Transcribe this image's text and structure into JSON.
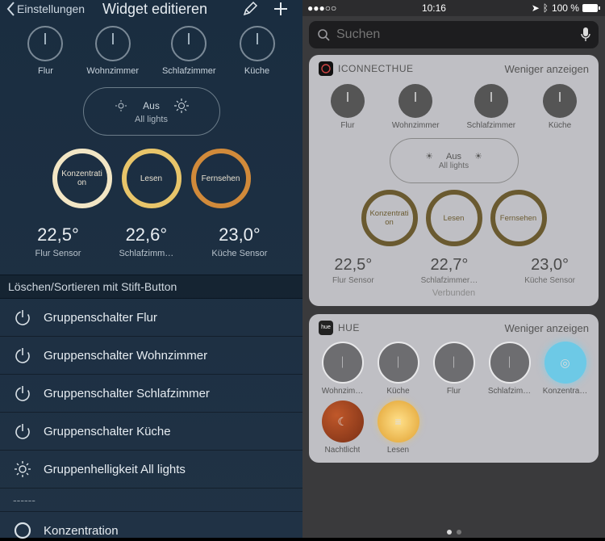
{
  "left": {
    "back_label": "Einstellungen",
    "title": "Widget editieren",
    "powers": [
      {
        "label": "Flur"
      },
      {
        "label": "Wohnzimmer"
      },
      {
        "label": "Schlafzimmer"
      },
      {
        "label": "Küche"
      }
    ],
    "all_lights": {
      "state": "Aus",
      "label": "All lights"
    },
    "scenes": [
      {
        "label": "Konzentration"
      },
      {
        "label": "Lesen"
      },
      {
        "label": "Fernsehen"
      }
    ],
    "sensors": [
      {
        "temp": "22,5°",
        "label": "Flur Sensor"
      },
      {
        "temp": "22,6°",
        "label": "Schlafzimm…"
      },
      {
        "temp": "23,0°",
        "label": "Küche Sensor"
      }
    ],
    "list_header": "Löschen/Sortieren mit Stift-Button",
    "items": [
      {
        "icon": "power",
        "label": "Gruppenschalter Flur"
      },
      {
        "icon": "power",
        "label": "Gruppenschalter Wohnzimmer"
      },
      {
        "icon": "power",
        "label": "Gruppenschalter Schlafzimmer"
      },
      {
        "icon": "power",
        "label": "Gruppenschalter Küche"
      },
      {
        "icon": "brightness",
        "label": "Gruppenhelligkeit All lights"
      }
    ],
    "divider": "------",
    "last_item": {
      "icon": "ring",
      "label": "Konzentration"
    }
  },
  "right": {
    "status": {
      "time": "10:16",
      "battery": "100 %"
    },
    "search_placeholder": "Suchen",
    "collapse_label": "Weniger anzeigen",
    "iconnecthue": {
      "title": "ICONNECTHUE",
      "powers": [
        {
          "label": "Flur"
        },
        {
          "label": "Wohnzimmer"
        },
        {
          "label": "Schlafzimmer"
        },
        {
          "label": "Küche"
        }
      ],
      "all_lights": {
        "state": "Aus",
        "label": "All lights"
      },
      "scenes": [
        {
          "label": "Konzentration"
        },
        {
          "label": "Lesen"
        },
        {
          "label": "Fernsehen"
        }
      ],
      "sensors": [
        {
          "temp": "22,5°",
          "label": "Flur Sensor"
        },
        {
          "temp": "22,7°",
          "label": "Schlafzimmer…"
        },
        {
          "temp": "23,0°",
          "label": "Küche Sensor"
        }
      ],
      "status": "Verbunden"
    },
    "hue": {
      "title": "HUE",
      "row1": [
        {
          "label": "Wohnzim…",
          "kind": "power"
        },
        {
          "label": "Küche",
          "kind": "power"
        },
        {
          "label": "Flur",
          "kind": "power"
        },
        {
          "label": "Schlafzim…",
          "kind": "power"
        },
        {
          "label": "Konzentra…",
          "kind": "on"
        }
      ],
      "row2": [
        {
          "label": "Nachtlicht",
          "kind": "nacht"
        },
        {
          "label": "Lesen",
          "kind": "lesen2"
        }
      ]
    }
  }
}
